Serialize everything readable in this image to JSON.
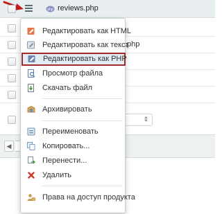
{
  "file": {
    "name": "reviews.php"
  },
  "background": {
    "row_text_partial": ".php"
  },
  "menu": {
    "items": [
      {
        "label": "Редактировать как HTML",
        "icon": "edit-html-icon",
        "color": "#e8744a"
      },
      {
        "label": "Редактировать как текст",
        "icon": "edit-text-icon",
        "color": "#8a9aa8"
      },
      {
        "label": "Редактировать как PHP",
        "icon": "edit-php-icon",
        "color": "#6f86b3",
        "highlighted": true
      },
      {
        "label": "Просмотр файла",
        "icon": "view-file-icon",
        "color": "#5a7fb0"
      },
      {
        "label": "Скачать файл",
        "icon": "download-file-icon",
        "color": "#4a9a4a"
      },
      {
        "label": "Архивировать",
        "icon": "archive-icon",
        "color": "#c8963c"
      },
      {
        "label": "Переименовать",
        "icon": "rename-icon",
        "color": "#6e8fb8"
      },
      {
        "label": "Копировать...",
        "icon": "copy-icon",
        "color": "#7b9cc9"
      },
      {
        "label": "Перенести...",
        "icon": "move-icon",
        "color": "#7f8f9a"
      },
      {
        "label": "Удалить",
        "icon": "delete-icon",
        "color": "#d23a2a"
      },
      {
        "label": "Права на доступ продукта",
        "icon": "access-rights-icon",
        "color": "#c89a52"
      }
    ]
  },
  "colors": {
    "highlight_border": "#9e2b2b",
    "arrow": "#c0201c"
  }
}
